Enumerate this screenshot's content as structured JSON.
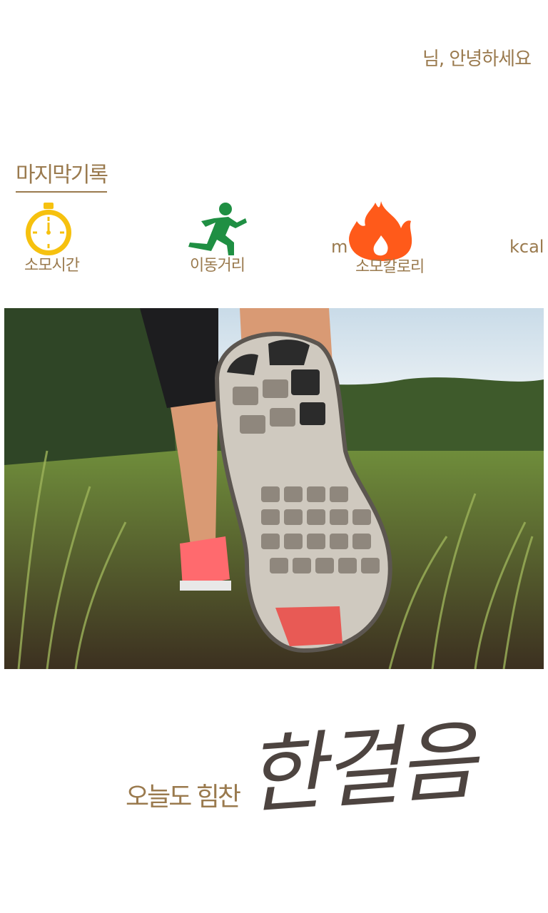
{
  "header": {
    "greeting": "님, 안녕하세요"
  },
  "last_record": {
    "title": "마지막기록",
    "stats": {
      "time_label": "소모시간",
      "distance_label": "이동거리",
      "distance_unit": "m",
      "calorie_label": "소모칼로리",
      "calorie_unit": "kcal"
    }
  },
  "slogan": {
    "small": "오늘도 힘찬",
    "big": "한걸음"
  },
  "colors": {
    "text_brown": "#9a7a4e",
    "runner_green": "#1f8f43",
    "fire_orange": "#ff5a1a",
    "clock_yellow": "#f6c10f"
  },
  "icons": {
    "time": "stopwatch-icon",
    "distance": "runner-icon",
    "calorie": "fire-icon"
  },
  "photo": {
    "name": "running-shoe-photo"
  }
}
